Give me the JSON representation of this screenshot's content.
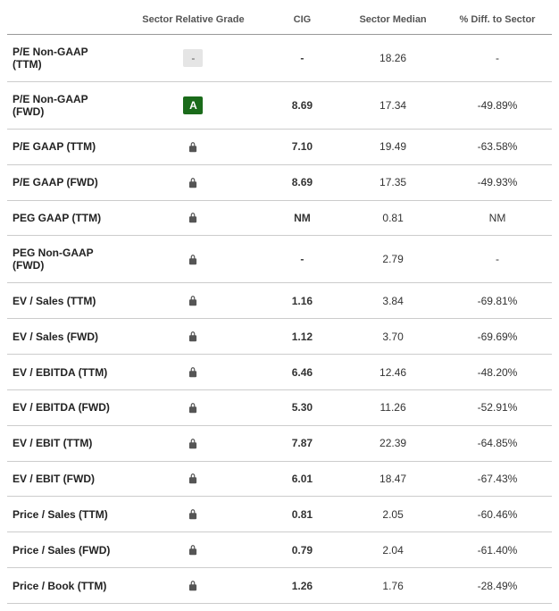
{
  "headers": {
    "metric": "",
    "grade": "Sector Relative Grade",
    "cig": "CIG",
    "median": "Sector Median",
    "diff": "% Diff. to Sector"
  },
  "rows": [
    {
      "metric": "P/E Non-GAAP (TTM)",
      "grade_type": "dash",
      "grade_text": "-",
      "cig": "-",
      "median": "18.26",
      "diff": "-"
    },
    {
      "metric": "P/E Non-GAAP (FWD)",
      "grade_type": "A",
      "grade_text": "A",
      "cig": "8.69",
      "median": "17.34",
      "diff": "-49.89%"
    },
    {
      "metric": "P/E GAAP (TTM)",
      "grade_type": "lock",
      "grade_text": "",
      "cig": "7.10",
      "median": "19.49",
      "diff": "-63.58%"
    },
    {
      "metric": "P/E GAAP (FWD)",
      "grade_type": "lock",
      "grade_text": "",
      "cig": "8.69",
      "median": "17.35",
      "diff": "-49.93%"
    },
    {
      "metric": "PEG GAAP (TTM)",
      "grade_type": "lock",
      "grade_text": "",
      "cig": "NM",
      "median": "0.81",
      "diff": "NM"
    },
    {
      "metric": "PEG Non-GAAP (FWD)",
      "grade_type": "lock",
      "grade_text": "",
      "cig": "-",
      "median": "2.79",
      "diff": "-"
    },
    {
      "metric": "EV / Sales (TTM)",
      "grade_type": "lock",
      "grade_text": "",
      "cig": "1.16",
      "median": "3.84",
      "diff": "-69.81%"
    },
    {
      "metric": "EV / Sales (FWD)",
      "grade_type": "lock",
      "grade_text": "",
      "cig": "1.12",
      "median": "3.70",
      "diff": "-69.69%"
    },
    {
      "metric": "EV / EBITDA (TTM)",
      "grade_type": "lock",
      "grade_text": "",
      "cig": "6.46",
      "median": "12.46",
      "diff": "-48.20%"
    },
    {
      "metric": "EV / EBITDA (FWD)",
      "grade_type": "lock",
      "grade_text": "",
      "cig": "5.30",
      "median": "11.26",
      "diff": "-52.91%"
    },
    {
      "metric": "EV / EBIT (TTM)",
      "grade_type": "lock",
      "grade_text": "",
      "cig": "7.87",
      "median": "22.39",
      "diff": "-64.85%"
    },
    {
      "metric": "EV / EBIT (FWD)",
      "grade_type": "lock",
      "grade_text": "",
      "cig": "6.01",
      "median": "18.47",
      "diff": "-67.43%"
    },
    {
      "metric": "Price / Sales (TTM)",
      "grade_type": "lock",
      "grade_text": "",
      "cig": "0.81",
      "median": "2.05",
      "diff": "-60.46%"
    },
    {
      "metric": "Price / Sales (FWD)",
      "grade_type": "lock",
      "grade_text": "",
      "cig": "0.79",
      "median": "2.04",
      "diff": "-61.40%"
    },
    {
      "metric": "Price / Book (TTM)",
      "grade_type": "lock",
      "grade_text": "",
      "cig": "1.26",
      "median": "1.76",
      "diff": "-28.49%"
    }
  ]
}
